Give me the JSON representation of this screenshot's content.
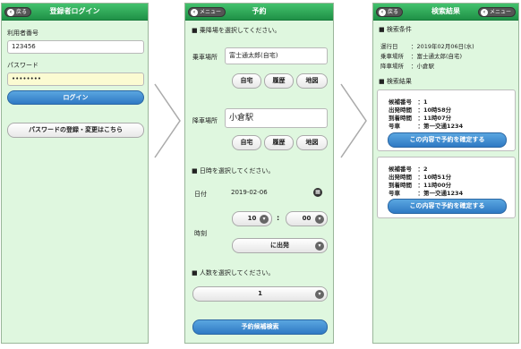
{
  "screen1": {
    "back_label": "戻る",
    "title": "登録者ログイン",
    "user_number_label": "利用者番号",
    "user_number_value": "123456",
    "password_label": "パスワード",
    "password_value": "••••••••",
    "login_button": "ログイン",
    "register_button": "パスワードの登録・変更はこちら"
  },
  "screen2": {
    "menu_label": "メニュー",
    "title": "予約",
    "section_place": "■ 乗降場を選択してください。",
    "pickup_label": "乗車場所",
    "pickup_value": "富士通太郎(自宅)",
    "home_button": "自宅",
    "history_button": "履歴",
    "map_button": "地図",
    "dropoff_label": "降車場所",
    "dropoff_value": "小倉駅",
    "section_datetime": "■ 日時を選択してください。",
    "date_label": "日付",
    "date_value": "2019-02-06",
    "time_label": "時刻",
    "hour_value": "10",
    "minute_value": "00",
    "time_separator": ":",
    "departure_option": "に出発",
    "section_people": "■ 人数を選択してください。",
    "people_value": "1",
    "search_button": "予約候補検索"
  },
  "screen3": {
    "back_label": "戻る",
    "title": "検索結果",
    "menu_label": "メニュー",
    "section_conditions": "■ 検索条件",
    "conditions": [
      {
        "label": "運行日",
        "value": "：2019年02月06日(水)"
      },
      {
        "label": "乗車場所",
        "value": "：富士通太郎(自宅)"
      },
      {
        "label": "降車場所",
        "value": "：小倉駅"
      }
    ],
    "section_results": "■ 検索結果",
    "results": [
      {
        "candidate": "候補番号　：1",
        "departure": "出発時間　：10時58分",
        "arrival": "到着時間　：11時07分",
        "car": "号車　　　：第一交通1234",
        "confirm_button": "この内容で予約を確定する"
      },
      {
        "candidate": "候補番号　：2",
        "departure": "出発時間　：10時51分",
        "arrival": "到着時間　：11時00分",
        "car": "号車　　　：第一交通1234",
        "confirm_button": "この内容で予約を確定する"
      }
    ]
  },
  "colors": {
    "header_green": "#2fa85a",
    "screen_bg": "#dff7df",
    "button_blue": "#3d86cc"
  }
}
